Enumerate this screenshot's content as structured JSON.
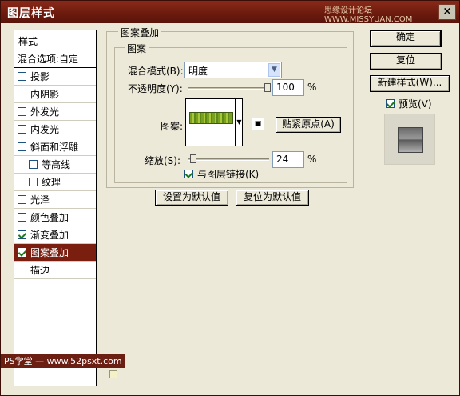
{
  "window": {
    "title": "图层样式",
    "watermark": "思缘设计论坛 WWW.MISSYUAN.COM",
    "close_label": "×"
  },
  "sidebar": {
    "header": "样式",
    "blend_options": "混合选项:自定",
    "items": [
      {
        "label": "投影",
        "checked": false
      },
      {
        "label": "内阴影",
        "checked": false
      },
      {
        "label": "外发光",
        "checked": false
      },
      {
        "label": "内发光",
        "checked": false
      },
      {
        "label": "斜面和浮雕",
        "checked": false
      },
      {
        "label": "等高线",
        "checked": false
      },
      {
        "label": "纹理",
        "checked": false
      },
      {
        "label": "光泽",
        "checked": false
      },
      {
        "label": "颜色叠加",
        "checked": false
      },
      {
        "label": "渐变叠加",
        "checked": true
      },
      {
        "label": "图案叠加",
        "checked": true
      },
      {
        "label": "描边",
        "checked": false
      }
    ],
    "footer": "PS学堂 — www.52psxt.com"
  },
  "panel": {
    "group_title": "图案叠加",
    "subgroup_title": "图案",
    "blend_mode_label": "混合模式(B):",
    "blend_mode_value": "明度",
    "opacity_label": "不透明度(Y):",
    "opacity_value": "100",
    "opacity_percent": 100,
    "percent_sign": "%",
    "pattern_label": "图案:",
    "snap_origin_button": "贴紧原点(A)",
    "scale_label": "缩放(S):",
    "scale_value": "24",
    "scale_percent": 24,
    "scale_percent_sign": "%",
    "link_layer_label": "与图层链接(K)",
    "link_layer_checked": true,
    "set_default_button": "设置为默认值",
    "reset_default_button": "复位为默认值"
  },
  "actions": {
    "ok": "确定",
    "reset": "复位",
    "new_style": "新建样式(W)...",
    "preview_label": "预览(V)",
    "preview_checked": true
  }
}
